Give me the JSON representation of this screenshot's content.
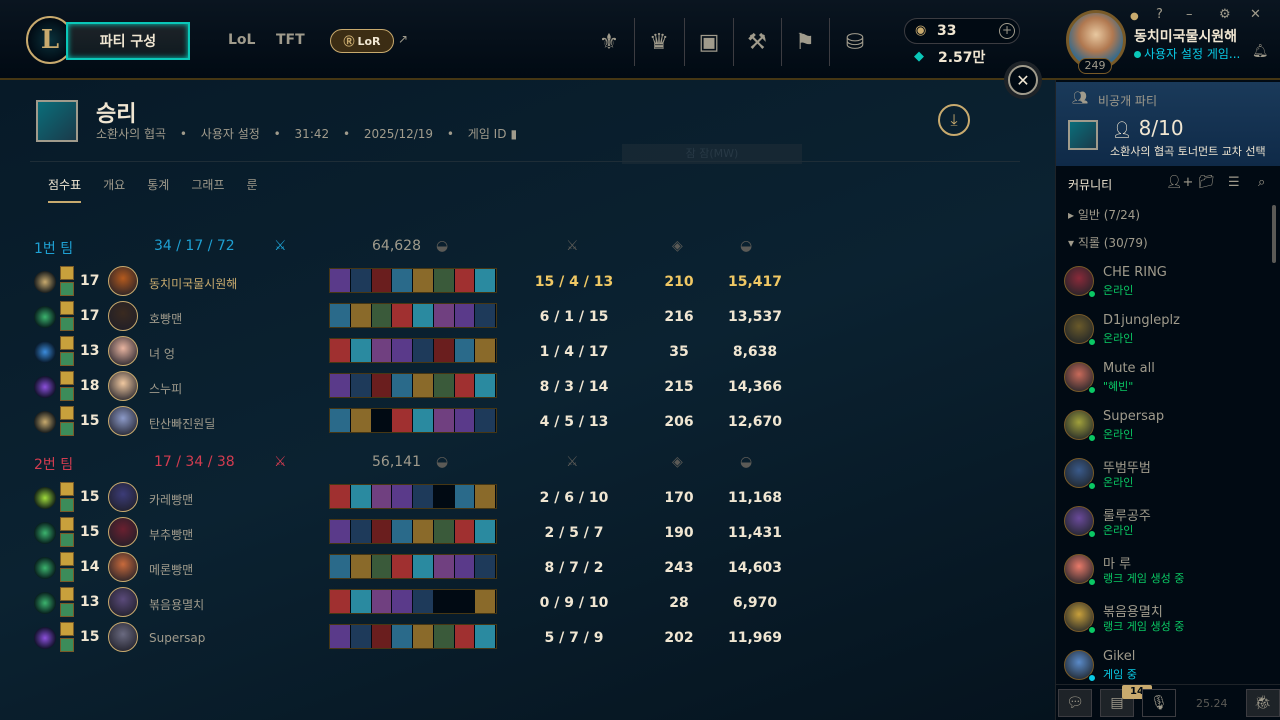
{
  "header": {
    "party_button": "파티 구성",
    "nav": [
      "LoL",
      "TFT"
    ],
    "lor_label": "LoR",
    "currency": {
      "rp": "33",
      "be": "2.57만"
    },
    "profile": {
      "name": "동치미국물시원해",
      "status": "사용자 설정 게임...",
      "level": "249"
    }
  },
  "game": {
    "title": "승리",
    "meta": [
      "소환사의 협곡",
      "사용자 설정",
      "31:42",
      "2025/12/19",
      "게임 ID"
    ],
    "tabs": [
      "점수표",
      "개요",
      "통계",
      "그래프",
      "룬"
    ],
    "faded_label": "잠 잠(MW)"
  },
  "teams": [
    {
      "name": "1번 팀",
      "kda": "34 / 17 / 72",
      "gold": "64,628",
      "color": "#1ea0d2",
      "players": [
        {
          "lvl": "17",
          "name": "동치미국물시원해",
          "kda": "15 / 4 / 13",
          "cs": "210",
          "gold": "15,417",
          "me": true
        },
        {
          "lvl": "17",
          "name": "호빵맨",
          "kda": "6 / 1 / 15",
          "cs": "216",
          "gold": "13,537"
        },
        {
          "lvl": "13",
          "name": "녀 엉",
          "kda": "1 / 4 / 17",
          "cs": "35",
          "gold": "8,638"
        },
        {
          "lvl": "18",
          "name": "스누피",
          "kda": "8 / 3 / 14",
          "cs": "215",
          "gold": "14,366"
        },
        {
          "lvl": "15",
          "name": "탄산빠진원딜",
          "kda": "4 / 5 / 13",
          "cs": "206",
          "gold": "12,670"
        }
      ]
    },
    {
      "name": "2번 팀",
      "kda": "17 / 34 / 38",
      "gold": "56,141",
      "color": "#d23c50",
      "players": [
        {
          "lvl": "15",
          "name": "카레빵맨",
          "kda": "2 / 6 / 10",
          "cs": "170",
          "gold": "11,168"
        },
        {
          "lvl": "15",
          "name": "부추빵맨",
          "kda": "2 / 5 / 7",
          "cs": "190",
          "gold": "11,431"
        },
        {
          "lvl": "14",
          "name": "메론빵맨",
          "kda": "8 / 7 / 2",
          "cs": "243",
          "gold": "14,603"
        },
        {
          "lvl": "13",
          "name": "볶음용멸치",
          "kda": "0 / 9 / 10",
          "cs": "28",
          "gold": "6,970"
        },
        {
          "lvl": "15",
          "name": "Supersap",
          "kda": "5 / 7 / 9",
          "cs": "202",
          "gold": "11,969"
        }
      ]
    }
  ],
  "sidebar": {
    "party_label": "비공개 파티",
    "party_count": "8/10",
    "party_mode": "소환사의 협곡 토너먼트 교차 선택",
    "community": "커뮤니티",
    "groups": [
      {
        "label": "일반 (7/24)"
      },
      {
        "label": "직롤 (30/79)"
      }
    ],
    "friends": [
      {
        "name": "CHE RING",
        "status": "온라인"
      },
      {
        "name": "D1jungleplz",
        "status": "온라인"
      },
      {
        "name": "Mute all",
        "status": "\"혜빈\""
      },
      {
        "name": "Supersap",
        "status": "온라인"
      },
      {
        "name": "뚜범뚜범",
        "status": "온라인"
      },
      {
        "name": "룰루공주",
        "status": "온라인"
      },
      {
        "name": "마 루",
        "status": "랭크 게임 생성 중"
      },
      {
        "name": "볶음용멸치",
        "status": "랭크 게임 생성 중"
      },
      {
        "name": "Gikel",
        "status": "게임 중"
      }
    ],
    "notif_count": "14",
    "time": "25.24"
  }
}
